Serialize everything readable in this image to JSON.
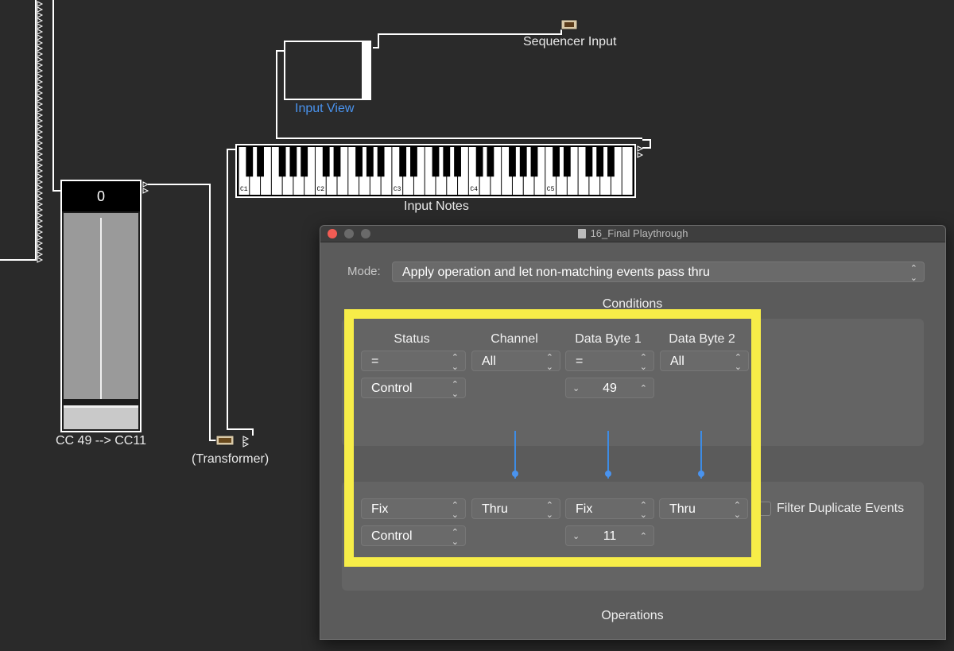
{
  "environment": {
    "fader": {
      "value": "0",
      "label": "CC 49 --> CC11"
    },
    "transformer_label": "(Transformer)",
    "input_view_label": "Input View",
    "sequencer_input_label": "Sequencer Input",
    "keyboard": {
      "label": "Input Notes",
      "octave_labels": [
        "C1",
        "C2",
        "C3",
        "C4",
        "C5"
      ]
    }
  },
  "window": {
    "title": "16_Final Playthrough",
    "mode_label": "Mode:",
    "mode_value": "Apply operation and let non-matching events pass thru",
    "conditions_title": "Conditions",
    "operations_title": "Operations",
    "columns": [
      "Status",
      "Channel",
      "Data Byte 1",
      "Data Byte 2"
    ],
    "conditions": {
      "status_op": "=",
      "channel_op": "All",
      "db1_op": "=",
      "db2_op": "All",
      "status_value": "Control",
      "db1_value": "49"
    },
    "operations": {
      "status_op": "Fix",
      "channel_op": "Thru",
      "db1_op": "Fix",
      "db2_op": "Thru",
      "status_value": "Control",
      "db1_value": "11"
    },
    "filter_duplicate_label": "Filter Duplicate Events"
  },
  "colors": {
    "highlight": "#f7ed48",
    "link_blue": "#4a93ee",
    "window_bg": "#5b5b5b",
    "canvas_bg": "#2a2a2a"
  }
}
